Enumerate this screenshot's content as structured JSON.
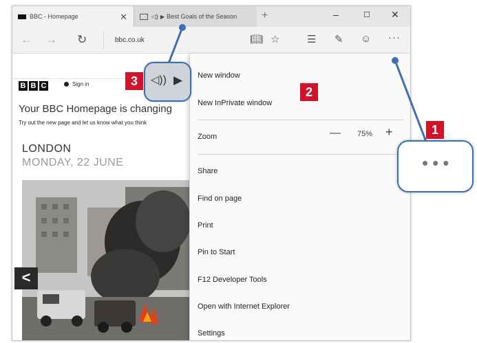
{
  "tabs": [
    {
      "title": "BBC - Homepage"
    },
    {
      "title": "Best Goals of the Season"
    }
  ],
  "address": "bbc.co.uk",
  "page": {
    "signin": "Sign in",
    "headline": "Your BBC Homepage is changing",
    "subline": "Try out the new page and let us know what you think",
    "city": "LONDON",
    "date": "MONDAY, 22 JUNE"
  },
  "menu": {
    "new_window": "New window",
    "new_inprivate": "New InPrivate window",
    "zoom_label": "Zoom",
    "zoom_value": "75%",
    "items": [
      "Share",
      "Find on page",
      "Print",
      "Pin to Start",
      "F12 Developer Tools",
      "Open with Internet Explorer",
      "Settings"
    ]
  },
  "callouts": {
    "one": "1",
    "two": "2",
    "three": "3"
  },
  "colors": {
    "badge_red": "#d3132a",
    "callout_blue": "#3b6fb4",
    "bbc_black": "#111111"
  },
  "icons": [
    "bbc-favicon",
    "tab-preview-icon",
    "speaker-icon",
    "play-icon",
    "close-icon",
    "plus-icon",
    "minimize-icon",
    "maximize-icon",
    "back-arrow-icon",
    "forward-arrow-icon",
    "refresh-icon",
    "reading-view-icon",
    "favorite-star-icon",
    "hub-icon",
    "web-note-icon",
    "feedback-smiley-icon",
    "more-dots-icon",
    "carousel-left-arrow-icon"
  ]
}
